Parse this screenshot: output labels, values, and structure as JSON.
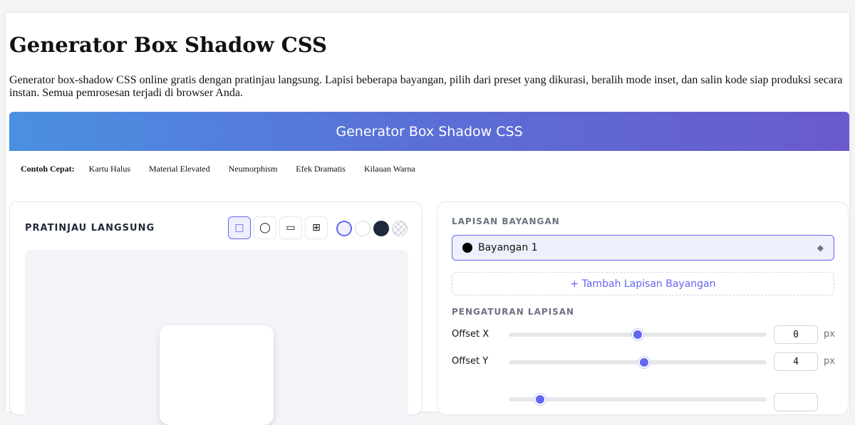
{
  "page": {
    "title": "Generator Box Shadow CSS",
    "description": "Generator box-shadow CSS online gratis dengan pratinjau langsung. Lapisi beberapa bayangan, pilih dari preset yang dikurasi, beralih mode inset, dan salin kode siap produksi secara instan. Semua pemrosesan terjadi di browser Anda."
  },
  "banner": {
    "title": "Generator Box Shadow CSS"
  },
  "quick_examples": {
    "label": "Contoh Cepat:",
    "items": [
      "Kartu Halus",
      "Material Elevated",
      "Neumorphism",
      "Efek Dramatis",
      "Kilauan Warna"
    ]
  },
  "preview": {
    "title": "PRATINJAU LANGSUNG",
    "shapes": [
      {
        "glyph": "□",
        "icon": "square-shape-icon",
        "active": true
      },
      {
        "glyph": "◯",
        "icon": "circle-shape-icon",
        "active": false
      },
      {
        "glyph": "▭",
        "icon": "rectangle-shape-icon",
        "active": false
      },
      {
        "glyph": "⊞",
        "icon": "grid-shape-icon",
        "active": false
      }
    ],
    "backgrounds": [
      {
        "color": "#f1f1fb",
        "active": true
      },
      {
        "color": "#ffffff",
        "active": false
      },
      {
        "color": "#1e293b",
        "active": false
      },
      {
        "color": "checker",
        "active": false
      }
    ]
  },
  "layers": {
    "title": "LAPISAN BAYANGAN",
    "items": [
      {
        "name": "Bayangan 1",
        "color": "#000000",
        "grip_icon": "◆"
      }
    ],
    "add_label": "+ Tambah Lapisan Bayangan"
  },
  "settings": {
    "title": "PENGATURAN LAPISAN",
    "rows": [
      {
        "label": "Offset X",
        "value": "0",
        "unit": "px",
        "fraction": 0.5
      },
      {
        "label": "Offset Y",
        "value": "4",
        "unit": "px",
        "fraction": 0.525
      }
    ]
  },
  "colors": {
    "accent": "#6366f1",
    "banner_start": "#4a90e2",
    "banner_end": "#6a5acd"
  }
}
